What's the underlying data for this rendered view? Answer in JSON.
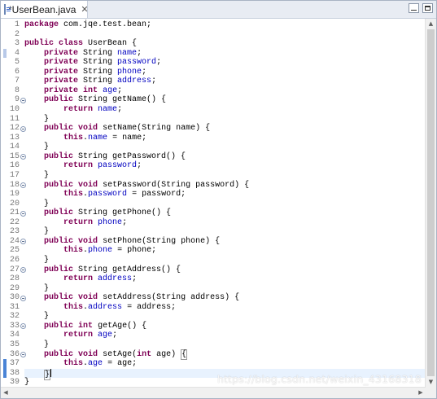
{
  "tab": {
    "title": "*UserBean.java",
    "close_glyph": "✕"
  },
  "editor": {
    "lines": [
      [
        {
          "t": "package",
          "c": "kw"
        },
        {
          "t": " com.jqe.test.bean;"
        }
      ],
      [],
      [
        {
          "t": "public",
          "c": "kw"
        },
        {
          "t": " "
        },
        {
          "t": "class",
          "c": "kw"
        },
        {
          "t": " UserBean {"
        }
      ],
      [
        {
          "t": "    "
        },
        {
          "t": "private",
          "c": "kw"
        },
        {
          "t": " String "
        },
        {
          "t": "name",
          "c": "fld"
        },
        {
          "t": ";"
        }
      ],
      [
        {
          "t": "    "
        },
        {
          "t": "private",
          "c": "kw"
        },
        {
          "t": " String "
        },
        {
          "t": "password",
          "c": "fld"
        },
        {
          "t": ";"
        }
      ],
      [
        {
          "t": "    "
        },
        {
          "t": "private",
          "c": "kw"
        },
        {
          "t": " String "
        },
        {
          "t": "phone",
          "c": "fld"
        },
        {
          "t": ";"
        }
      ],
      [
        {
          "t": "    "
        },
        {
          "t": "private",
          "c": "kw"
        },
        {
          "t": " String "
        },
        {
          "t": "address",
          "c": "fld"
        },
        {
          "t": ";"
        }
      ],
      [
        {
          "t": "    "
        },
        {
          "t": "private",
          "c": "kw"
        },
        {
          "t": " "
        },
        {
          "t": "int",
          "c": "kw"
        },
        {
          "t": " "
        },
        {
          "t": "age",
          "c": "fld"
        },
        {
          "t": ";"
        }
      ],
      [
        {
          "t": "    "
        },
        {
          "t": "public",
          "c": "kw"
        },
        {
          "t": " String getName() {"
        }
      ],
      [
        {
          "t": "        "
        },
        {
          "t": "return",
          "c": "kw"
        },
        {
          "t": " "
        },
        {
          "t": "name",
          "c": "fld"
        },
        {
          "t": ";"
        }
      ],
      [
        {
          "t": "    }"
        }
      ],
      [
        {
          "t": "    "
        },
        {
          "t": "public",
          "c": "kw"
        },
        {
          "t": " "
        },
        {
          "t": "void",
          "c": "kw"
        },
        {
          "t": " setName(String name) {"
        }
      ],
      [
        {
          "t": "        "
        },
        {
          "t": "this",
          "c": "kw"
        },
        {
          "t": "."
        },
        {
          "t": "name",
          "c": "fld"
        },
        {
          "t": " = name;"
        }
      ],
      [
        {
          "t": "    }"
        }
      ],
      [
        {
          "t": "    "
        },
        {
          "t": "public",
          "c": "kw"
        },
        {
          "t": " String getPassword() {"
        }
      ],
      [
        {
          "t": "        "
        },
        {
          "t": "return",
          "c": "kw"
        },
        {
          "t": " "
        },
        {
          "t": "password",
          "c": "fld"
        },
        {
          "t": ";"
        }
      ],
      [
        {
          "t": "    }"
        }
      ],
      [
        {
          "t": "    "
        },
        {
          "t": "public",
          "c": "kw"
        },
        {
          "t": " "
        },
        {
          "t": "void",
          "c": "kw"
        },
        {
          "t": " setPassword(String password) {"
        }
      ],
      [
        {
          "t": "        "
        },
        {
          "t": "this",
          "c": "kw"
        },
        {
          "t": "."
        },
        {
          "t": "password",
          "c": "fld"
        },
        {
          "t": " = password;"
        }
      ],
      [
        {
          "t": "    }"
        }
      ],
      [
        {
          "t": "    "
        },
        {
          "t": "public",
          "c": "kw"
        },
        {
          "t": " String getPhone() {"
        }
      ],
      [
        {
          "t": "        "
        },
        {
          "t": "return",
          "c": "kw"
        },
        {
          "t": " "
        },
        {
          "t": "phone",
          "c": "fld"
        },
        {
          "t": ";"
        }
      ],
      [
        {
          "t": "    }"
        }
      ],
      [
        {
          "t": "    "
        },
        {
          "t": "public",
          "c": "kw"
        },
        {
          "t": " "
        },
        {
          "t": "void",
          "c": "kw"
        },
        {
          "t": " setPhone(String phone) {"
        }
      ],
      [
        {
          "t": "        "
        },
        {
          "t": "this",
          "c": "kw"
        },
        {
          "t": "."
        },
        {
          "t": "phone",
          "c": "fld"
        },
        {
          "t": " = phone;"
        }
      ],
      [
        {
          "t": "    }"
        }
      ],
      [
        {
          "t": "    "
        },
        {
          "t": "public",
          "c": "kw"
        },
        {
          "t": " String getAddress() {"
        }
      ],
      [
        {
          "t": "        "
        },
        {
          "t": "return",
          "c": "kw"
        },
        {
          "t": " "
        },
        {
          "t": "address",
          "c": "fld"
        },
        {
          "t": ";"
        }
      ],
      [
        {
          "t": "    }"
        }
      ],
      [
        {
          "t": "    "
        },
        {
          "t": "public",
          "c": "kw"
        },
        {
          "t": " "
        },
        {
          "t": "void",
          "c": "kw"
        },
        {
          "t": " setAddress(String address) {"
        }
      ],
      [
        {
          "t": "        "
        },
        {
          "t": "this",
          "c": "kw"
        },
        {
          "t": "."
        },
        {
          "t": "address",
          "c": "fld"
        },
        {
          "t": " = address;"
        }
      ],
      [
        {
          "t": "    }"
        }
      ],
      [
        {
          "t": "    "
        },
        {
          "t": "public",
          "c": "kw"
        },
        {
          "t": " "
        },
        {
          "t": "int",
          "c": "kw"
        },
        {
          "t": " getAge() {"
        }
      ],
      [
        {
          "t": "        "
        },
        {
          "t": "return",
          "c": "kw"
        },
        {
          "t": " "
        },
        {
          "t": "age",
          "c": "fld"
        },
        {
          "t": ";"
        }
      ],
      [
        {
          "t": "    }"
        }
      ],
      [
        {
          "t": "    "
        },
        {
          "t": "public",
          "c": "kw"
        },
        {
          "t": " "
        },
        {
          "t": "void",
          "c": "kw"
        },
        {
          "t": " setAge("
        },
        {
          "t": "int",
          "c": "kw"
        },
        {
          "t": " age) "
        },
        {
          "t": "{",
          "c": "bracket-box"
        }
      ],
      [
        {
          "t": "        "
        },
        {
          "t": "this",
          "c": "kw"
        },
        {
          "t": "."
        },
        {
          "t": "age",
          "c": "fld"
        },
        {
          "t": " = age;"
        }
      ],
      [
        {
          "t": "    "
        },
        {
          "t": "}",
          "c": "bracket-box"
        },
        {
          "t": "",
          "c": "cursor"
        }
      ],
      [
        {
          "t": "}"
        }
      ]
    ],
    "fold_lines": [
      9,
      12,
      15,
      18,
      21,
      24,
      27,
      30,
      33,
      36
    ],
    "current_line": 38,
    "changed_lines": [
      4,
      37,
      38
    ]
  },
  "watermark": "https://blog.csdn.net/weixin_43168318"
}
